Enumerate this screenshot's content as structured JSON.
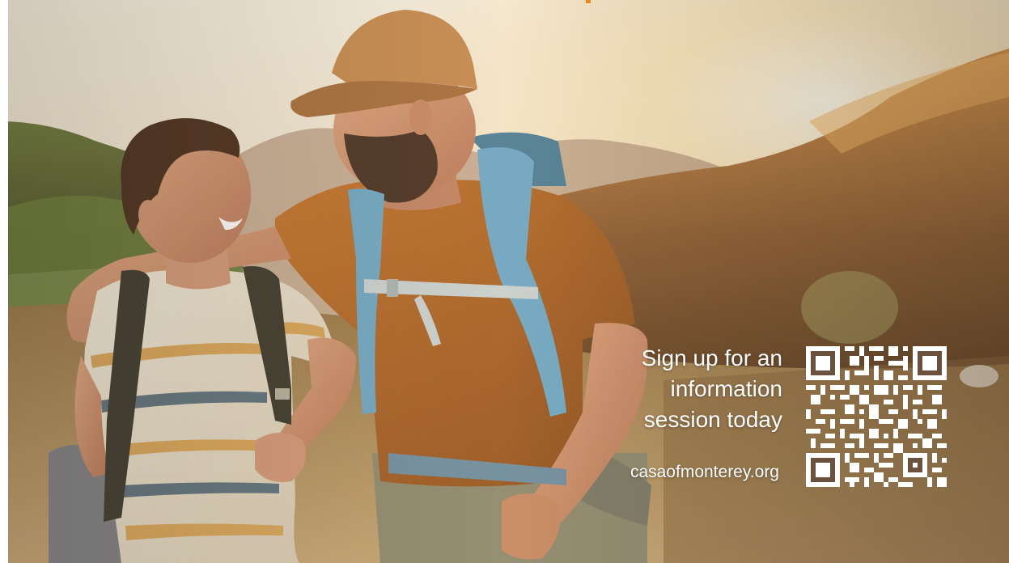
{
  "ad": {
    "cta_lines": [
      "Sign up for an",
      "information",
      "session today"
    ],
    "url": "casaofmonterey.org"
  },
  "colors": {
    "accent_orange": "#e8891f",
    "text": "#ffffff",
    "sky": "#f3ead7",
    "sun": "#fff6dc",
    "hill_light": "#c98a4a",
    "hill_dark": "#6e4a2c",
    "meadow": "#b38f5f",
    "man_shirt": "#b86a2c",
    "boy_shirt": "#ece2cf",
    "backpack_straps": "#6ea9c9",
    "cap": "#c58a52"
  },
  "icons": {
    "qr": "qr-code-icon"
  }
}
